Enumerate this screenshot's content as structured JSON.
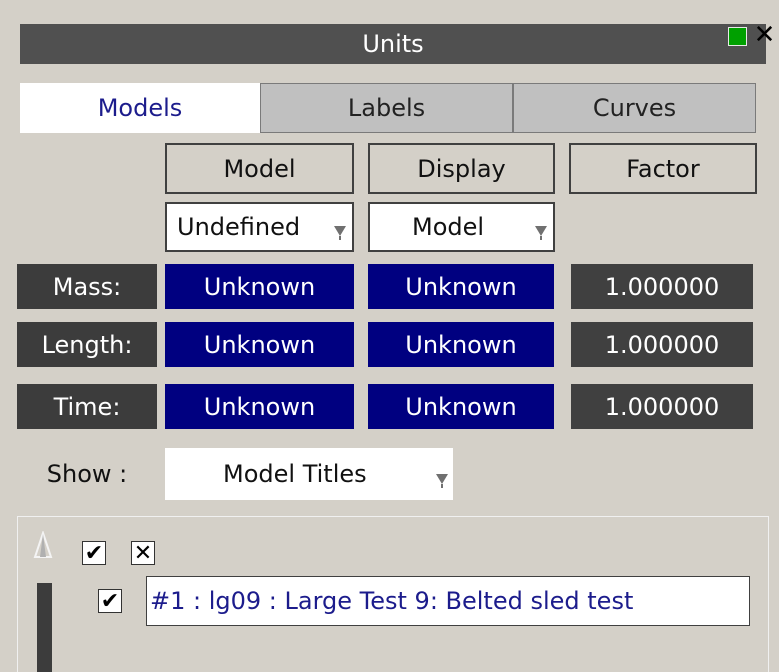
{
  "window": {
    "title": "Units",
    "close_glyph": "✕"
  },
  "tabs": [
    {
      "label": "Models",
      "active": true
    },
    {
      "label": "Labels",
      "active": false
    },
    {
      "label": "Curves",
      "active": false
    }
  ],
  "columns": {
    "model": "Model",
    "display": "Display",
    "factor": "Factor"
  },
  "dropdowns": {
    "model_system": "Undefined",
    "display_system": "Model"
  },
  "rows": [
    {
      "label": "Mass:",
      "model_unit": "Unknown",
      "display_unit": "Unknown",
      "factor": "1.000000"
    },
    {
      "label": "Length:",
      "model_unit": "Unknown",
      "display_unit": "Unknown",
      "factor": "1.000000"
    },
    {
      "label": "Time:",
      "model_unit": "Unknown",
      "display_unit": "Unknown",
      "factor": "1.000000"
    }
  ],
  "show": {
    "label": "Show :",
    "value": "Model Titles"
  },
  "model_list": {
    "select_all_glyph": "✔",
    "deselect_all_glyph": "✕",
    "items": [
      {
        "checked_glyph": "✔",
        "text": "#1 : lg09 : Large Test 9: Belted sled test"
      }
    ]
  },
  "colors": {
    "titlebar": "#505050",
    "unit_cell": "#000080",
    "factor_cell": "#404040",
    "row_label": "#3c3c3c",
    "dock_button": "#00a000",
    "link_text": "#1c1c8c"
  },
  "icons": {
    "dock": "dock-icon",
    "close": "close-icon",
    "dropdown": "dropdown-arrow-icon",
    "sort": "sort-triangle-icon",
    "check": "check-icon",
    "cross": "cross-icon"
  }
}
